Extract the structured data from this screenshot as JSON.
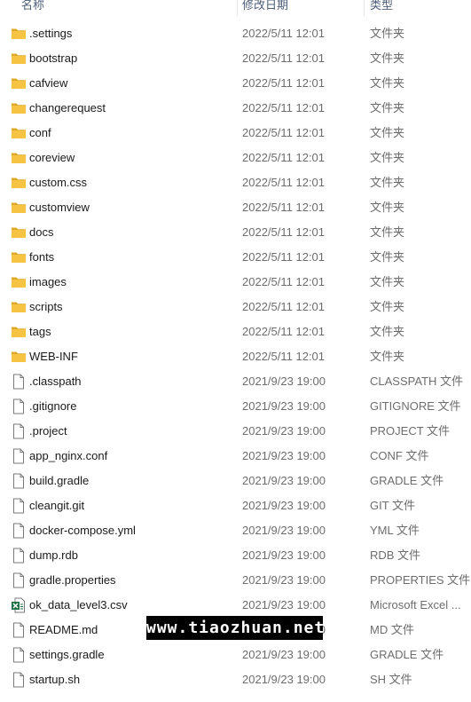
{
  "columns": {
    "name": "名称",
    "date": "修改日期",
    "type": "类型"
  },
  "colors": {
    "folder": "#f6c343",
    "folder_dark": "#e0a826",
    "file_border": "#7a7a7a",
    "excel_green": "#1e7145"
  },
  "files": [
    {
      "name": ".settings",
      "date": "2022/5/11 12:01",
      "type": "文件夹",
      "icon": "folder-icon"
    },
    {
      "name": "bootstrap",
      "date": "2022/5/11 12:01",
      "type": "文件夹",
      "icon": "folder-icon"
    },
    {
      "name": "cafview",
      "date": "2022/5/11 12:01",
      "type": "文件夹",
      "icon": "folder-icon"
    },
    {
      "name": "changerequest",
      "date": "2022/5/11 12:01",
      "type": "文件夹",
      "icon": "folder-icon"
    },
    {
      "name": "conf",
      "date": "2022/5/11 12:01",
      "type": "文件夹",
      "icon": "folder-icon"
    },
    {
      "name": "coreview",
      "date": "2022/5/11 12:01",
      "type": "文件夹",
      "icon": "folder-icon"
    },
    {
      "name": "custom.css",
      "date": "2022/5/11 12:01",
      "type": "文件夹",
      "icon": "folder-icon"
    },
    {
      "name": "customview",
      "date": "2022/5/11 12:01",
      "type": "文件夹",
      "icon": "folder-icon"
    },
    {
      "name": "docs",
      "date": "2022/5/11 12:01",
      "type": "文件夹",
      "icon": "folder-icon"
    },
    {
      "name": "fonts",
      "date": "2022/5/11 12:01",
      "type": "文件夹",
      "icon": "folder-icon"
    },
    {
      "name": "images",
      "date": "2022/5/11 12:01",
      "type": "文件夹",
      "icon": "folder-icon"
    },
    {
      "name": "scripts",
      "date": "2022/5/11 12:01",
      "type": "文件夹",
      "icon": "folder-icon"
    },
    {
      "name": "tags",
      "date": "2022/5/11 12:01",
      "type": "文件夹",
      "icon": "folder-icon"
    },
    {
      "name": "WEB-INF",
      "date": "2022/5/11 12:01",
      "type": "文件夹",
      "icon": "folder-icon"
    },
    {
      "name": ".classpath",
      "date": "2021/9/23 19:00",
      "type": "CLASSPATH 文件",
      "icon": "file-icon"
    },
    {
      "name": ".gitignore",
      "date": "2021/9/23 19:00",
      "type": "GITIGNORE 文件",
      "icon": "file-icon"
    },
    {
      "name": ".project",
      "date": "2021/9/23 19:00",
      "type": "PROJECT 文件",
      "icon": "file-icon"
    },
    {
      "name": "app_nginx.conf",
      "date": "2021/9/23 19:00",
      "type": "CONF 文件",
      "icon": "file-icon"
    },
    {
      "name": "build.gradle",
      "date": "2021/9/23 19:00",
      "type": "GRADLE 文件",
      "icon": "file-icon"
    },
    {
      "name": "cleangit.git",
      "date": "2021/9/23 19:00",
      "type": "GIT 文件",
      "icon": "file-icon"
    },
    {
      "name": "docker-compose.yml",
      "date": "2021/9/23 19:00",
      "type": "YML 文件",
      "icon": "file-icon"
    },
    {
      "name": "dump.rdb",
      "date": "2021/9/23 19:00",
      "type": "RDB 文件",
      "icon": "file-icon"
    },
    {
      "name": "gradle.properties",
      "date": "2021/9/23 19:00",
      "type": "PROPERTIES 文件",
      "icon": "file-icon"
    },
    {
      "name": "ok_data_level3.csv",
      "date": "2021/9/23 19:00",
      "type": "Microsoft Excel ...",
      "icon": "excel-icon"
    },
    {
      "name": "README.md",
      "date": "2021/9/23 19:00",
      "type": "MD 文件",
      "icon": "file-icon"
    },
    {
      "name": "settings.gradle",
      "date": "2021/9/23 19:00",
      "type": "GRADLE 文件",
      "icon": "file-icon"
    },
    {
      "name": "startup.sh",
      "date": "2021/9/23 19:00",
      "type": "SH 文件",
      "icon": "file-icon"
    }
  ],
  "watermark": "www.tiaozhuan.net"
}
